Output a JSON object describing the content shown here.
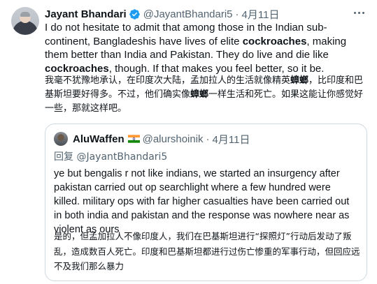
{
  "tweet": {
    "author_name": "Jayant Bhandari",
    "author_handle": "@JayantBhandari5",
    "separator": "·",
    "date": "4月11日",
    "verified_color": "#1d9bf0",
    "text_en": [
      {
        "text": "I do not hesitate to admit that among those in the Indian sub-continent, Bangladeshis have lives of elite ",
        "bold": false
      },
      {
        "text": "cockroaches",
        "bold": true
      },
      {
        "text": ", making them better than India and Pakistan. They do live and die like ",
        "bold": false
      },
      {
        "text": "cockroaches",
        "bold": true
      },
      {
        "text": ", though. If that makes you feel better, so it be.",
        "bold": false
      }
    ],
    "text_zh": [
      {
        "text": "我毫不犹豫地承认，在印度次大陆，孟加拉人的生活就像精英",
        "bold": false
      },
      {
        "text": "蟑螂",
        "bold": true
      },
      {
        "text": "，比印度和巴基斯坦要好得多。不过，他们确实像",
        "bold": false
      },
      {
        "text": "蟑螂",
        "bold": true
      },
      {
        "text": "一样生活和死亡。如果这能让你感觉好一些，那就这样吧。",
        "bold": false
      }
    ]
  },
  "quote": {
    "author_name": "AluWaffen",
    "author_handle": "@alurshoinik",
    "separator": "·",
    "date": "4月11日",
    "reply_prefix": "回复",
    "reply_to": "@JayantBhandari5",
    "text_en": "ye but bengalis r not like indians, we started an insurgency after pakistan carried out op searchlight where a few hundred were killed. military ops with far higher casualties have been carried out in both india and pakistan and the response was nowhere near as violent as ours",
    "text_zh": "是的，但孟加拉人不像印度人，我们在巴基斯坦进行“探照灯”行动后发动了叛乱，造成数百人死亡。印度和巴基斯坦都进行过伤亡惨重的军事行动，但回应远不及我们那么暴力"
  },
  "icons": {
    "verified": "verified-badge-icon",
    "more": "more-options-icon",
    "flag": "india-flag-icon"
  }
}
